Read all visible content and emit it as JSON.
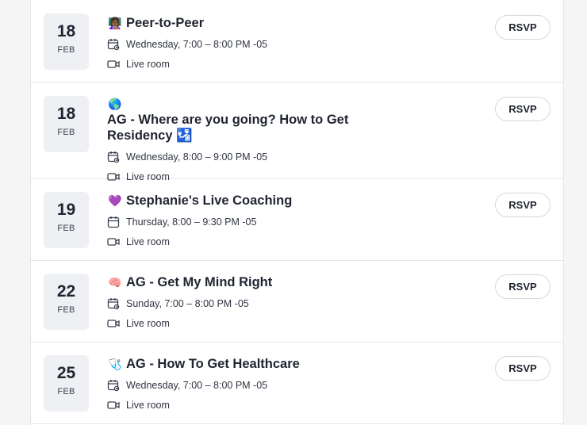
{
  "rsvp_label": "RSVP",
  "events": [
    {
      "day": "18",
      "month": "FEB",
      "emoji": "👩🏾‍🏫",
      "title": "Peer-to-Peer",
      "time": "Wednesday, 7:00 – 8:00 PM -05",
      "location": "Live room"
    },
    {
      "day": "18",
      "month": "FEB",
      "emoji": "🌎",
      "title": "AG - Where are you going? How to Get Residency",
      "title_suffix_emoji": "🛂",
      "time": "Wednesday, 8:00 – 9:00 PM -05",
      "location": "Live room"
    },
    {
      "day": "19",
      "month": "FEB",
      "emoji": "💜",
      "title": "Stephanie's Live Coaching",
      "time": "Thursday, 8:00 – 9:30 PM -05",
      "location": "Live room"
    },
    {
      "day": "22",
      "month": "FEB",
      "emoji": "🧠",
      "title": "AG - Get My Mind Right",
      "time": "Sunday, 7:00 – 8:00 PM -05",
      "location": "Live room"
    },
    {
      "day": "25",
      "month": "FEB",
      "emoji": "🩺",
      "title": "AG - How To Get Healthcare",
      "time": "Wednesday, 7:00 – 8:00 PM -05",
      "location": "Live room"
    }
  ],
  "icons": {
    "calendar": "calendar-recurring-icon",
    "video": "video-camera-icon"
  },
  "colors": {
    "tile_bg": "#eef0f3",
    "divider": "#e4e5e8",
    "text": "#1f2430"
  }
}
